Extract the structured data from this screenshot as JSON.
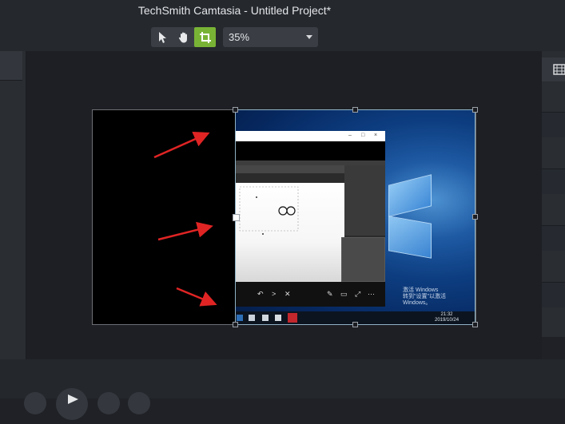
{
  "window": {
    "title": "TechSmith Camtasia - Untitled Project*"
  },
  "toolbar": {
    "tools": [
      {
        "name": "select-tool",
        "icon": "arrow-pointer-icon",
        "active": false
      },
      {
        "name": "pan-tool",
        "icon": "hand-icon",
        "active": false
      },
      {
        "name": "crop-tool",
        "icon": "crop-icon",
        "active": true
      }
    ],
    "zoom": {
      "value": "35%",
      "options_visible": [
        "35%"
      ]
    },
    "active_color": "#79b335"
  },
  "canvas": {
    "clip_desktop": {
      "watermark_line1": "激活 Windows",
      "watermark_line2": "转到\"设置\"以激活 Windows。",
      "clock_time": "21:32",
      "clock_date": "2019/10/24"
    },
    "annotation_arrows": 3,
    "arrow_color": "#e02424"
  }
}
